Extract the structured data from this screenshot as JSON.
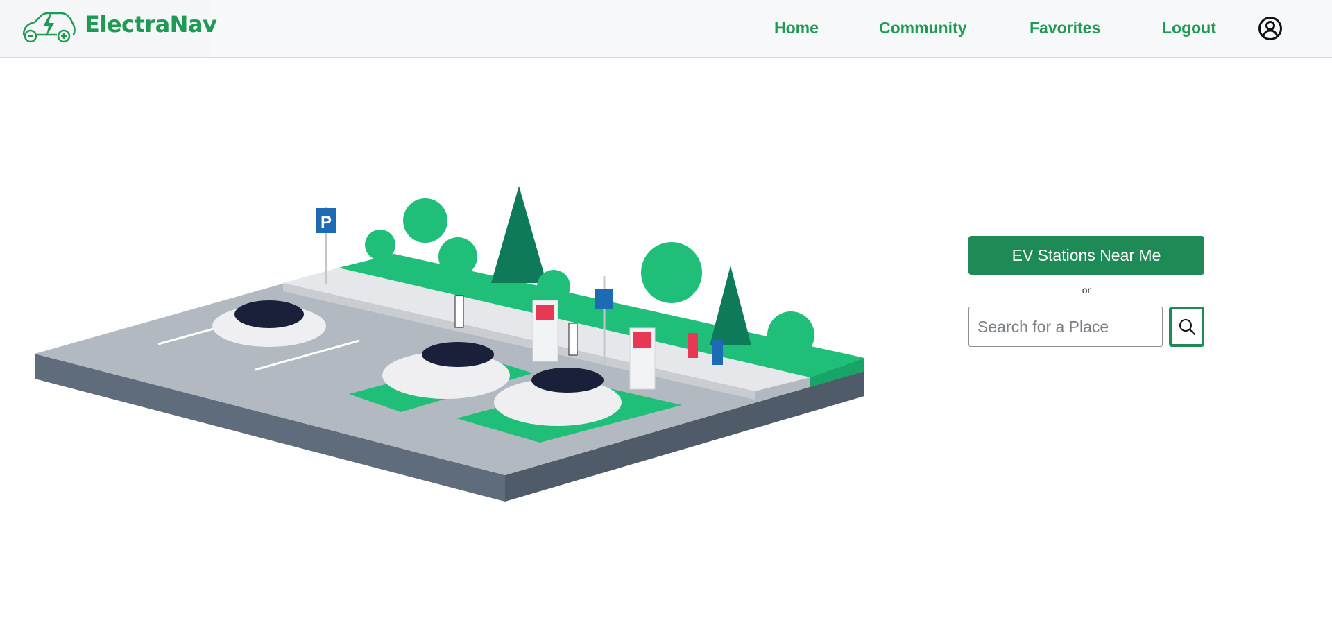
{
  "brand": {
    "name": "ElectraNav",
    "logo_icon": "ev-car-logo-icon",
    "color": "#1f9a54"
  },
  "nav": {
    "items": [
      {
        "label": "Home"
      },
      {
        "label": "Community"
      },
      {
        "label": "Favorites"
      },
      {
        "label": "Logout"
      }
    ],
    "profile_icon": "user-circle-icon"
  },
  "hero": {
    "illustration": "ev-charging-parking-lot-illustration"
  },
  "actions": {
    "near_me_label": "EV Stations Near Me",
    "or_label": "or",
    "search_placeholder": "Search for a Place",
    "search_icon": "search-icon",
    "accent": "#1e8a55"
  }
}
